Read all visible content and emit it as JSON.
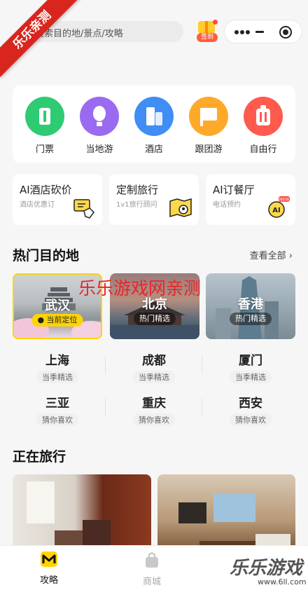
{
  "watermark": {
    "ribbon": "乐乐亲测",
    "center": "乐乐游戏网亲测",
    "corner_title": "乐乐游戏",
    "corner_url": "www.6ll.com"
  },
  "header": {
    "search_placeholder": "搜索目的地/景点/攻略",
    "checkin_label": "签到"
  },
  "categories": [
    {
      "label": "门票",
      "icon": "ticket-icon",
      "color": "#2fcb73"
    },
    {
      "label": "当地游",
      "icon": "balloon-icon",
      "color": "#9a6bf0"
    },
    {
      "label": "酒店",
      "icon": "building-icon",
      "color": "#3f8df5"
    },
    {
      "label": "跟团游",
      "icon": "flag-icon",
      "color": "#ffa92a"
    },
    {
      "label": "自由行",
      "icon": "luggage-icon",
      "color": "#ff5a4e"
    }
  ],
  "promos": [
    {
      "title": "AI酒店砍价",
      "subtitle": "酒店优惠订"
    },
    {
      "title": "定制旅行",
      "subtitle": "1v1旅行顾问"
    },
    {
      "title": "AI订餐厅",
      "subtitle": "电话预约",
      "badge": "NEW"
    }
  ],
  "hot_destinations": {
    "title": "热门目的地",
    "see_all": "查看全部",
    "tiles": [
      {
        "name": "武汉",
        "tag": "当前定位"
      },
      {
        "name": "北京",
        "tag": "热门精选"
      },
      {
        "name": "香港",
        "tag": "热门精选"
      }
    ],
    "cities": [
      {
        "name": "上海",
        "tag": "当季精选"
      },
      {
        "name": "成都",
        "tag": "当季精选"
      },
      {
        "name": "厦门",
        "tag": "当季精选"
      },
      {
        "name": "三亚",
        "tag": "猜你喜欢"
      },
      {
        "name": "重庆",
        "tag": "猜你喜欢"
      },
      {
        "name": "西安",
        "tag": "猜你喜欢"
      }
    ]
  },
  "traveling": {
    "title": "正在旅行"
  },
  "bottom_nav": [
    {
      "label": "攻略",
      "active": true
    },
    {
      "label": "商城",
      "active": false
    }
  ],
  "colors": {
    "accent": "#ffd400",
    "brand": "#ffcd2b",
    "text": "#222222"
  }
}
